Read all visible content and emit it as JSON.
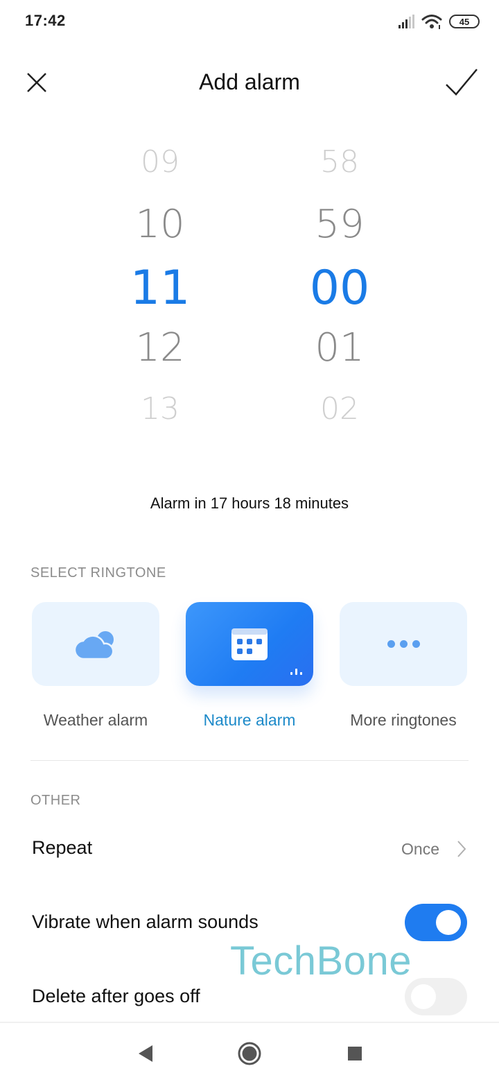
{
  "status_bar": {
    "time": "17:42",
    "battery": "45",
    "icons": [
      "signal-icon",
      "wifi-icon",
      "battery-icon"
    ]
  },
  "header": {
    "title": "Add alarm",
    "close_icon": "close-icon",
    "confirm_icon": "check-icon"
  },
  "picker": {
    "hours": [
      "09",
      "10",
      "11",
      "12",
      "13"
    ],
    "minutes": [
      "58",
      "59",
      "00",
      "01",
      "02"
    ],
    "selected_hour": "11",
    "selected_minute": "00"
  },
  "alarm_in_text": "Alarm in 17 hours 18 minutes",
  "ringtone_section": {
    "label": "SELECT RINGTONE",
    "items": [
      {
        "label": "Weather alarm",
        "icon": "cloud-icon",
        "selected": false
      },
      {
        "label": "Nature alarm",
        "icon": "calendar-icon",
        "selected": true
      },
      {
        "label": "More ringtones",
        "icon": "more-dots-icon",
        "selected": false
      }
    ]
  },
  "other_section": {
    "label": "OTHER",
    "repeat": {
      "label": "Repeat",
      "value": "Once"
    },
    "vibrate": {
      "label": "Vibrate when alarm sounds",
      "enabled": true
    },
    "delete_after": {
      "label": "Delete after goes off",
      "enabled": false
    }
  },
  "watermark": "TechBone",
  "nav_bar": {
    "buttons": [
      "back-icon",
      "home-icon",
      "recents-icon"
    ]
  },
  "colors": {
    "accent": "#1a7be6",
    "selected_label": "#1d8ac9",
    "card_bg": "#eaf4fe",
    "toggle_on": "#1f7cf0",
    "toggle_off": "#f0f0f0"
  }
}
